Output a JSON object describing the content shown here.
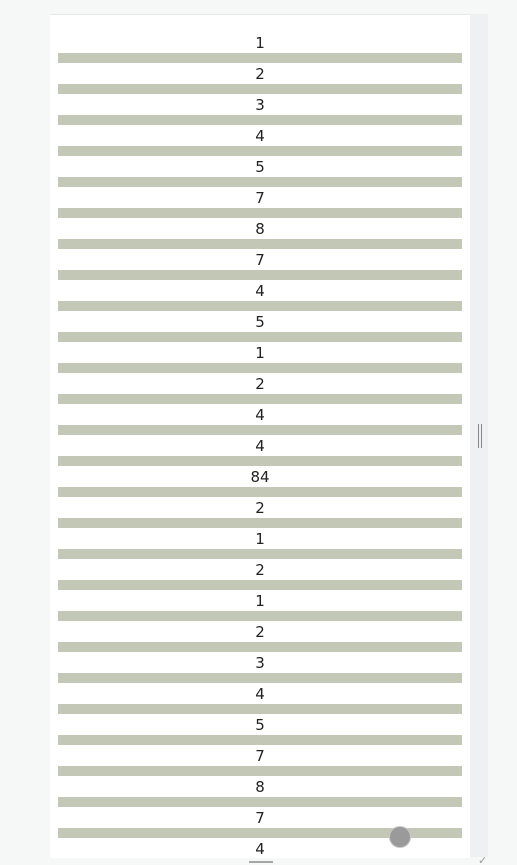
{
  "colors": {
    "bar": "#c2c7b6",
    "page_background": "#f6f7f7",
    "panel_background": "#ffffff"
  },
  "list": {
    "items": [
      {
        "label": "1"
      },
      {
        "label": "2"
      },
      {
        "label": "3"
      },
      {
        "label": "4"
      },
      {
        "label": "5"
      },
      {
        "label": "7"
      },
      {
        "label": "8"
      },
      {
        "label": "7"
      },
      {
        "label": "4"
      },
      {
        "label": "5"
      },
      {
        "label": "1"
      },
      {
        "label": "2"
      },
      {
        "label": "4"
      },
      {
        "label": "4"
      },
      {
        "label": "84"
      },
      {
        "label": "2"
      },
      {
        "label": "1"
      },
      {
        "label": "2"
      },
      {
        "label": "1"
      },
      {
        "label": "2"
      },
      {
        "label": "3"
      },
      {
        "label": "4"
      },
      {
        "label": "5"
      },
      {
        "label": "7"
      },
      {
        "label": "8"
      },
      {
        "label": "7"
      },
      {
        "label": "4"
      }
    ]
  },
  "icons": {
    "splitter": "grip-vertical-icon",
    "fab": "circle-button-icon",
    "corner": "check-icon"
  }
}
